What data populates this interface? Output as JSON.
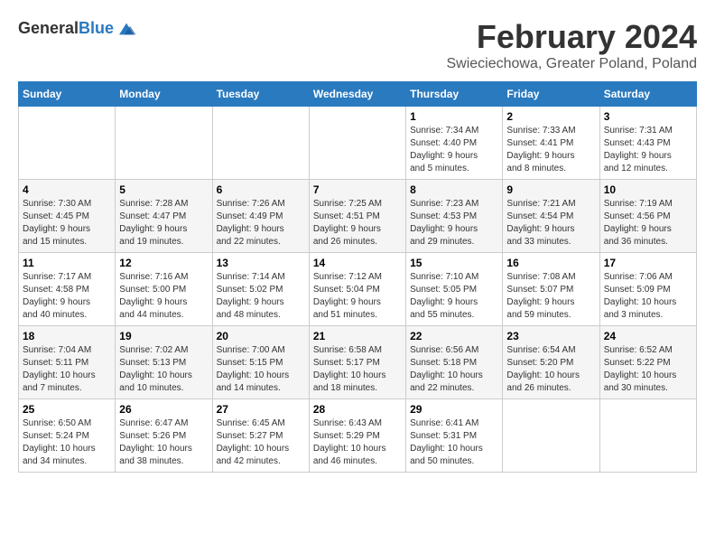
{
  "logo": {
    "general": "General",
    "blue": "Blue"
  },
  "title": "February 2024",
  "subtitle": "Swieciechowa, Greater Poland, Poland",
  "weekdays": [
    "Sunday",
    "Monday",
    "Tuesday",
    "Wednesday",
    "Thursday",
    "Friday",
    "Saturday"
  ],
  "weeks": [
    [
      {
        "day": "",
        "info": ""
      },
      {
        "day": "",
        "info": ""
      },
      {
        "day": "",
        "info": ""
      },
      {
        "day": "",
        "info": ""
      },
      {
        "day": "1",
        "info": "Sunrise: 7:34 AM\nSunset: 4:40 PM\nDaylight: 9 hours\nand 5 minutes."
      },
      {
        "day": "2",
        "info": "Sunrise: 7:33 AM\nSunset: 4:41 PM\nDaylight: 9 hours\nand 8 minutes."
      },
      {
        "day": "3",
        "info": "Sunrise: 7:31 AM\nSunset: 4:43 PM\nDaylight: 9 hours\nand 12 minutes."
      }
    ],
    [
      {
        "day": "4",
        "info": "Sunrise: 7:30 AM\nSunset: 4:45 PM\nDaylight: 9 hours\nand 15 minutes."
      },
      {
        "day": "5",
        "info": "Sunrise: 7:28 AM\nSunset: 4:47 PM\nDaylight: 9 hours\nand 19 minutes."
      },
      {
        "day": "6",
        "info": "Sunrise: 7:26 AM\nSunset: 4:49 PM\nDaylight: 9 hours\nand 22 minutes."
      },
      {
        "day": "7",
        "info": "Sunrise: 7:25 AM\nSunset: 4:51 PM\nDaylight: 9 hours\nand 26 minutes."
      },
      {
        "day": "8",
        "info": "Sunrise: 7:23 AM\nSunset: 4:53 PM\nDaylight: 9 hours\nand 29 minutes."
      },
      {
        "day": "9",
        "info": "Sunrise: 7:21 AM\nSunset: 4:54 PM\nDaylight: 9 hours\nand 33 minutes."
      },
      {
        "day": "10",
        "info": "Sunrise: 7:19 AM\nSunset: 4:56 PM\nDaylight: 9 hours\nand 36 minutes."
      }
    ],
    [
      {
        "day": "11",
        "info": "Sunrise: 7:17 AM\nSunset: 4:58 PM\nDaylight: 9 hours\nand 40 minutes."
      },
      {
        "day": "12",
        "info": "Sunrise: 7:16 AM\nSunset: 5:00 PM\nDaylight: 9 hours\nand 44 minutes."
      },
      {
        "day": "13",
        "info": "Sunrise: 7:14 AM\nSunset: 5:02 PM\nDaylight: 9 hours\nand 48 minutes."
      },
      {
        "day": "14",
        "info": "Sunrise: 7:12 AM\nSunset: 5:04 PM\nDaylight: 9 hours\nand 51 minutes."
      },
      {
        "day": "15",
        "info": "Sunrise: 7:10 AM\nSunset: 5:05 PM\nDaylight: 9 hours\nand 55 minutes."
      },
      {
        "day": "16",
        "info": "Sunrise: 7:08 AM\nSunset: 5:07 PM\nDaylight: 9 hours\nand 59 minutes."
      },
      {
        "day": "17",
        "info": "Sunrise: 7:06 AM\nSunset: 5:09 PM\nDaylight: 10 hours\nand 3 minutes."
      }
    ],
    [
      {
        "day": "18",
        "info": "Sunrise: 7:04 AM\nSunset: 5:11 PM\nDaylight: 10 hours\nand 7 minutes."
      },
      {
        "day": "19",
        "info": "Sunrise: 7:02 AM\nSunset: 5:13 PM\nDaylight: 10 hours\nand 10 minutes."
      },
      {
        "day": "20",
        "info": "Sunrise: 7:00 AM\nSunset: 5:15 PM\nDaylight: 10 hours\nand 14 minutes."
      },
      {
        "day": "21",
        "info": "Sunrise: 6:58 AM\nSunset: 5:17 PM\nDaylight: 10 hours\nand 18 minutes."
      },
      {
        "day": "22",
        "info": "Sunrise: 6:56 AM\nSunset: 5:18 PM\nDaylight: 10 hours\nand 22 minutes."
      },
      {
        "day": "23",
        "info": "Sunrise: 6:54 AM\nSunset: 5:20 PM\nDaylight: 10 hours\nand 26 minutes."
      },
      {
        "day": "24",
        "info": "Sunrise: 6:52 AM\nSunset: 5:22 PM\nDaylight: 10 hours\nand 30 minutes."
      }
    ],
    [
      {
        "day": "25",
        "info": "Sunrise: 6:50 AM\nSunset: 5:24 PM\nDaylight: 10 hours\nand 34 minutes."
      },
      {
        "day": "26",
        "info": "Sunrise: 6:47 AM\nSunset: 5:26 PM\nDaylight: 10 hours\nand 38 minutes."
      },
      {
        "day": "27",
        "info": "Sunrise: 6:45 AM\nSunset: 5:27 PM\nDaylight: 10 hours\nand 42 minutes."
      },
      {
        "day": "28",
        "info": "Sunrise: 6:43 AM\nSunset: 5:29 PM\nDaylight: 10 hours\nand 46 minutes."
      },
      {
        "day": "29",
        "info": "Sunrise: 6:41 AM\nSunset: 5:31 PM\nDaylight: 10 hours\nand 50 minutes."
      },
      {
        "day": "",
        "info": ""
      },
      {
        "day": "",
        "info": ""
      }
    ]
  ]
}
